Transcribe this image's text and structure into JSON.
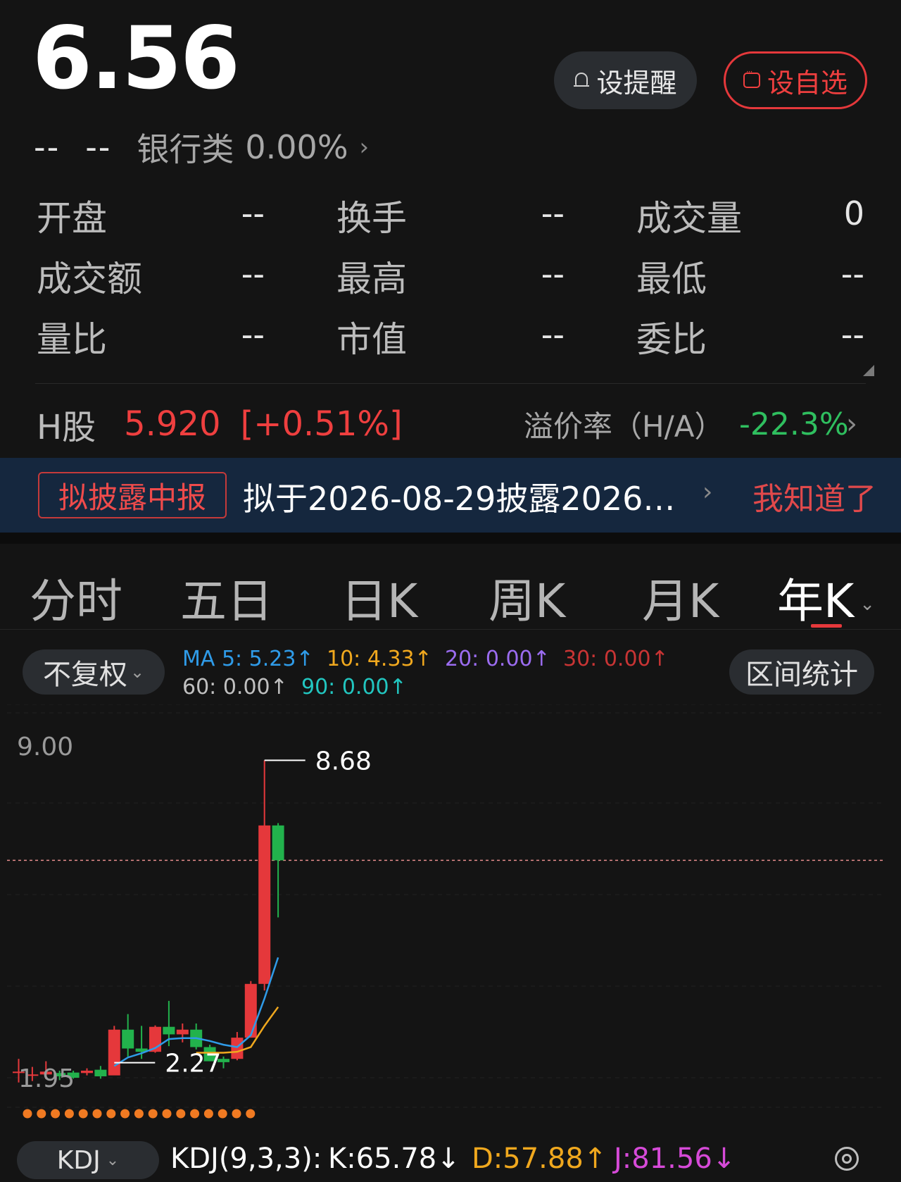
{
  "quote": {
    "price": "6.56",
    "change": "--",
    "change_pct": "--",
    "sector": "银行类",
    "sector_pct": "0.00%"
  },
  "actions": {
    "alert_label": "设提醒",
    "watch_label": "设自选"
  },
  "stats": [
    {
      "label": "开盘",
      "value": "--"
    },
    {
      "label": "换手",
      "value": "--"
    },
    {
      "label": "成交量",
      "value": "0"
    },
    {
      "label": "成交额",
      "value": "--"
    },
    {
      "label": "最高",
      "value": "--"
    },
    {
      "label": "最低",
      "value": "--"
    },
    {
      "label": "量比",
      "value": "--"
    },
    {
      "label": "市值",
      "value": "--"
    },
    {
      "label": "委比",
      "value": "--"
    }
  ],
  "h_share": {
    "label": "H股",
    "price": "5.920",
    "change_pct": "[+0.51%]",
    "premium_label": "溢价率（H/A）",
    "premium_value": "-22.3%"
  },
  "notice": {
    "tag": "拟披露中报",
    "text": "拟于2026-08-29披露2026…",
    "dismiss": "我知道了"
  },
  "tabs": [
    "分时",
    "五日",
    "日K",
    "周K",
    "月K",
    "年K"
  ],
  "active_tab": "年K",
  "chart_controls": {
    "adjust_label": "不复权",
    "range_label": "区间统计"
  },
  "ma": {
    "ma5": "MA 5: 5.23↑",
    "ma10": "10: 4.33↑",
    "ma20": "20: 0.00↑",
    "ma30": "30: 0.00↑",
    "ma60": "60: 0.00↑",
    "ma90": "90: 0.00↑"
  },
  "colors": {
    "up": "#e5383b",
    "down": "#22b24c",
    "ma5": "#2f9be8",
    "ma10": "#f0a81e",
    "ma20": "#9b6cf0",
    "ma30": "#c83434",
    "ma60": "#c0c0c0",
    "ma90": "#22c6c0"
  },
  "chart_data": {
    "type": "candlestick",
    "y_axis_labels": [
      "9.00",
      "1.95"
    ],
    "high_label": "8.68",
    "low_label": "2.27",
    "reference_price": 6.56,
    "ylim": [
      1.95,
      9.0
    ],
    "candles": [
      {
        "open": 2.05,
        "close": 2.08,
        "high": 2.35,
        "low": 1.85
      },
      {
        "open": 2.02,
        "close": 2.02,
        "high": 2.18,
        "low": 1.88
      },
      {
        "open": 2.02,
        "close": 2.08,
        "high": 2.3,
        "low": 1.92
      },
      {
        "open": 2.05,
        "close": 1.98,
        "high": 2.1,
        "low": 1.9
      },
      {
        "open": 2.06,
        "close": 1.95,
        "high": 2.1,
        "low": 1.93
      },
      {
        "open": 2.05,
        "close": 2.1,
        "high": 2.15,
        "low": 2.0
      },
      {
        "open": 2.12,
        "close": 1.98,
        "high": 2.2,
        "low": 1.93
      },
      {
        "open": 2.0,
        "close": 2.97,
        "high": 3.05,
        "low": 2.27
      },
      {
        "open": 2.97,
        "close": 2.57,
        "high": 3.3,
        "low": 2.4
      },
      {
        "open": 2.57,
        "close": 2.5,
        "high": 3.05,
        "low": 2.35
      },
      {
        "open": 2.5,
        "close": 3.03,
        "high": 3.06,
        "low": 2.48
      },
      {
        "open": 3.03,
        "close": 2.87,
        "high": 3.58,
        "low": 2.62
      },
      {
        "open": 2.87,
        "close": 2.97,
        "high": 3.1,
        "low": 2.7
      },
      {
        "open": 2.97,
        "close": 2.6,
        "high": 3.1,
        "low": 2.55
      },
      {
        "open": 2.6,
        "close": 2.3,
        "high": 2.65,
        "low": 2.3
      },
      {
        "open": 2.35,
        "close": 2.28,
        "high": 2.4,
        "low": 2.15
      },
      {
        "open": 2.35,
        "close": 2.8,
        "high": 2.92,
        "low": 2.32
      },
      {
        "open": 2.8,
        "close": 3.94,
        "high": 4.0,
        "low": 2.8
      },
      {
        "open": 3.94,
        "close": 7.3,
        "high": 8.68,
        "low": 3.8
      },
      {
        "open": 7.3,
        "close": 6.56,
        "high": 7.35,
        "low": 5.35
      }
    ],
    "ma5": [
      null,
      null,
      null,
      null,
      null,
      null,
      null,
      2.2,
      2.38,
      2.47,
      2.58,
      2.77,
      2.79,
      2.79,
      2.73,
      2.65,
      2.6,
      2.85,
      3.63,
      4.5
    ],
    "ma10": [
      null,
      null,
      null,
      null,
      null,
      null,
      null,
      null,
      null,
      null,
      null,
      null,
      null,
      2.48,
      2.48,
      2.48,
      2.5,
      2.6,
      3.05,
      3.45
    ]
  },
  "kdj": {
    "selector": "KDJ",
    "params": "KDJ(9,3,3):",
    "k": "K:65.78↓",
    "d": "D:57.88↑",
    "j": "J:81.56↓"
  }
}
